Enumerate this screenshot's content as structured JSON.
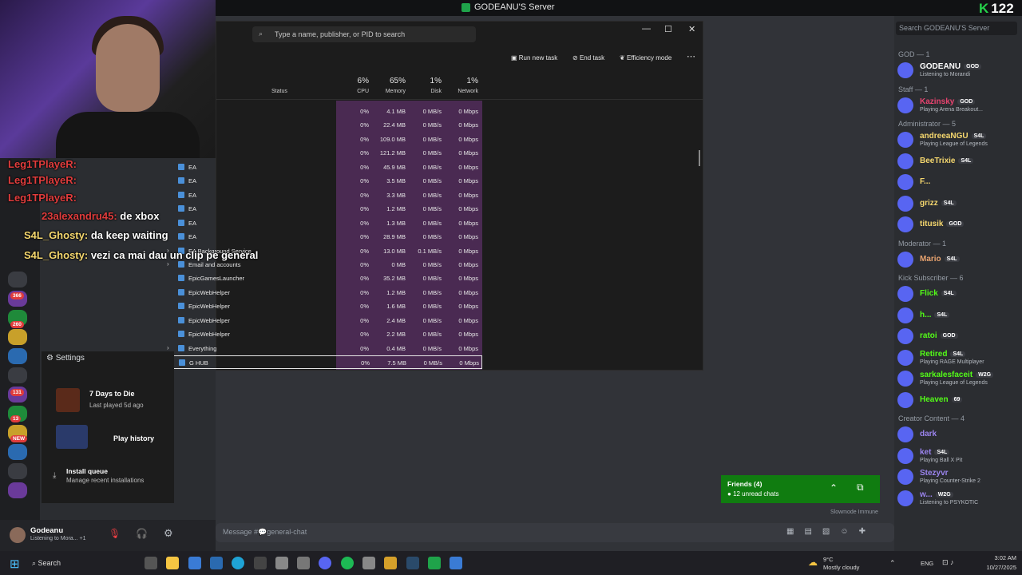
{
  "window": {
    "title": "GODEANU'S Server",
    "view_count": "122"
  },
  "task_manager": {
    "search_placeholder": "Type a name, publisher, or PID to search",
    "toolbar": {
      "run_new_task": "Run new task",
      "end_task": "End task",
      "efficiency_mode": "Efficiency mode",
      "more": "⋯"
    },
    "columns": {
      "status": "Status",
      "cpu_pct": "6%",
      "cpu": "CPU",
      "memory_pct": "65%",
      "memory": "Memory",
      "disk_pct": "1%",
      "disk": "Disk",
      "network_pct": "1%",
      "network": "Network"
    },
    "rows": [
      {
        "name": "",
        "cpu": "0%",
        "mem": "4.1 MB",
        "disk": "0 MB/s",
        "net": "0 Mbps"
      },
      {
        "name": "",
        "cpu": "0%",
        "mem": "22.4 MB",
        "disk": "0 MB/s",
        "net": "0 Mbps"
      },
      {
        "name": "",
        "cpu": "0%",
        "mem": "109.0 MB",
        "disk": "0 MB/s",
        "net": "0 Mbps"
      },
      {
        "name": "",
        "cpu": "0%",
        "mem": "121.2 MB",
        "disk": "0 MB/s",
        "net": "0 Mbps"
      },
      {
        "name": "EA",
        "cpu": "0%",
        "mem": "45.9 MB",
        "disk": "0 MB/s",
        "net": "0 Mbps"
      },
      {
        "name": "EA",
        "cpu": "0%",
        "mem": "3.5 MB",
        "disk": "0 MB/s",
        "net": "0 Mbps"
      },
      {
        "name": "EA",
        "cpu": "0%",
        "mem": "3.3 MB",
        "disk": "0 MB/s",
        "net": "0 Mbps"
      },
      {
        "name": "EA",
        "cpu": "0%",
        "mem": "1.2 MB",
        "disk": "0 MB/s",
        "net": "0 Mbps"
      },
      {
        "name": "EA",
        "cpu": "0%",
        "mem": "1.3 MB",
        "disk": "0 MB/s",
        "net": "0 Mbps"
      },
      {
        "name": "EA",
        "cpu": "0%",
        "mem": "28.9 MB",
        "disk": "0 MB/s",
        "net": "0 Mbps"
      },
      {
        "name": "EA Background Service",
        "cpu": "0%",
        "mem": "13.0 MB",
        "disk": "0.1 MB/s",
        "net": "0 Mbps"
      },
      {
        "name": "Email and accounts",
        "cpu": "0%",
        "mem": "0 MB",
        "disk": "0 MB/s",
        "net": "0 Mbps"
      },
      {
        "name": "EpicGamesLauncher",
        "cpu": "0%",
        "mem": "35.2 MB",
        "disk": "0 MB/s",
        "net": "0 Mbps"
      },
      {
        "name": "EpicWebHelper",
        "cpu": "0%",
        "mem": "1.2 MB",
        "disk": "0 MB/s",
        "net": "0 Mbps"
      },
      {
        "name": "EpicWebHelper",
        "cpu": "0%",
        "mem": "1.6 MB",
        "disk": "0 MB/s",
        "net": "0 Mbps"
      },
      {
        "name": "EpicWebHelper",
        "cpu": "0%",
        "mem": "2.4 MB",
        "disk": "0 MB/s",
        "net": "0 Mbps"
      },
      {
        "name": "EpicWebHelper",
        "cpu": "0%",
        "mem": "2.2 MB",
        "disk": "0 MB/s",
        "net": "0 Mbps"
      },
      {
        "name": "Everything",
        "cpu": "0%",
        "mem": "0.4 MB",
        "disk": "0 MB/s",
        "net": "0 Mbps"
      },
      {
        "name": "G HUB",
        "cpu": "0%",
        "mem": "7.5 MB",
        "disk": "0 MB/s",
        "net": "0 Mbps"
      }
    ]
  },
  "chat_overlay": [
    {
      "user": "Leg1TPlayeR:",
      "msg": ""
    },
    {
      "user": "Leg1TPlayeR:",
      "msg": ""
    },
    {
      "user": "Leg1TPlayeR:",
      "msg": ""
    },
    {
      "user": "23alexandru45:",
      "msg": "de xbox"
    },
    {
      "user": "S4L_Ghosty:",
      "msg": "da keep waiting"
    },
    {
      "user": "S4L_Ghosty:",
      "msg": "vezi ca mai dau un clip pe general"
    }
  ],
  "xbox_panel": {
    "settings": "Settings",
    "game_title": "7 Days to Die",
    "game_sub": "Last played 5d ago",
    "play_history": "Play history",
    "install_queue": "Install queue",
    "install_queue_sub": "Manage recent installations"
  },
  "members": {
    "search_placeholder": "Search GODEANU'S Server",
    "groups": [
      {
        "label": "GOD — 1",
        "items": [
          {
            "name": "GODEANU",
            "tag": "GOD",
            "status": "Listening to Morandi",
            "color": "#ffffff"
          }
        ]
      },
      {
        "label": "Staff — 1",
        "items": [
          {
            "name": "Kazinsky",
            "tag": "GOD",
            "status": "Playing Arena Breakout...",
            "color": "#e8436f"
          }
        ]
      },
      {
        "label": "Administrator — 5",
        "items": [
          {
            "name": "andreeaNGU",
            "tag": "S4L",
            "status": "Playing League of Legends",
            "color": "#f5d76e"
          },
          {
            "name": "BeeTrixie",
            "tag": "S4L",
            "status": "",
            "color": "#f5d76e"
          },
          {
            "name": "F...",
            "tag": "",
            "status": "",
            "color": "#f5d76e"
          },
          {
            "name": "grizz",
            "tag": "S4L",
            "status": "",
            "color": "#f5d76e"
          },
          {
            "name": "titusik",
            "tag": "GOD",
            "status": "",
            "color": "#f5d76e"
          }
        ]
      },
      {
        "label": "Moderator — 1",
        "items": [
          {
            "name": "Mario",
            "tag": "S4L",
            "status": "",
            "color": "#e8a36f"
          }
        ]
      },
      {
        "label": "Kick Subscriber — 6",
        "items": [
          {
            "name": "Flick",
            "tag": "S4L",
            "status": "",
            "color": "#53fc18"
          },
          {
            "name": "h...",
            "tag": "S4L",
            "status": "",
            "color": "#53fc18"
          },
          {
            "name": "ratoi",
            "tag": "GOD",
            "status": "",
            "color": "#53fc18"
          },
          {
            "name": "Retired",
            "tag": "S4L",
            "status": "Playing RAGE Multiplayer",
            "color": "#53fc18"
          },
          {
            "name": "sarkalesfaceit",
            "tag": "W2G",
            "status": "Playing League of Legends",
            "color": "#53fc18"
          },
          {
            "name": "Heaven",
            "tag": "69",
            "status": "",
            "color": "#53fc18"
          }
        ]
      },
      {
        "label": "Creator Content — 4",
        "items": [
          {
            "name": "dark",
            "tag": "",
            "status": "",
            "color": "#9b84ee"
          },
          {
            "name": "ket",
            "tag": "S4L",
            "status": "Playing Ball X Pit",
            "color": "#9b84ee"
          },
          {
            "name": "Stezyvr",
            "tag": "",
            "status": "Playing Counter-Strike 2",
            "color": "#9b84ee"
          },
          {
            "name": "w...",
            "tag": "W2G",
            "status": "Listening to PSYKOTIC",
            "color": "#9b84ee"
          }
        ]
      }
    ]
  },
  "composer": {
    "placeholder": "Message #💬general-chat",
    "slowmode": "Slowmode Immune"
  },
  "user_panel": {
    "name": "Godeanu",
    "status": "Listening to Mora...",
    "count": "+1"
  },
  "friends": {
    "title": "Friends (4)",
    "sub": "12 unread chats"
  },
  "taskbar": {
    "search": "Search",
    "weather_temp": "9°C",
    "weather_desc": "Mostly cloudy",
    "lang": "ENG",
    "time": "3:02 AM",
    "date": "10/27/2025"
  },
  "rail_badges": [
    "366",
    "260",
    "131",
    "13",
    "NEW"
  ],
  "colors": {
    "accent_green": "#107c10",
    "heat": "#4a2a52",
    "kick_green": "#53fc18"
  }
}
